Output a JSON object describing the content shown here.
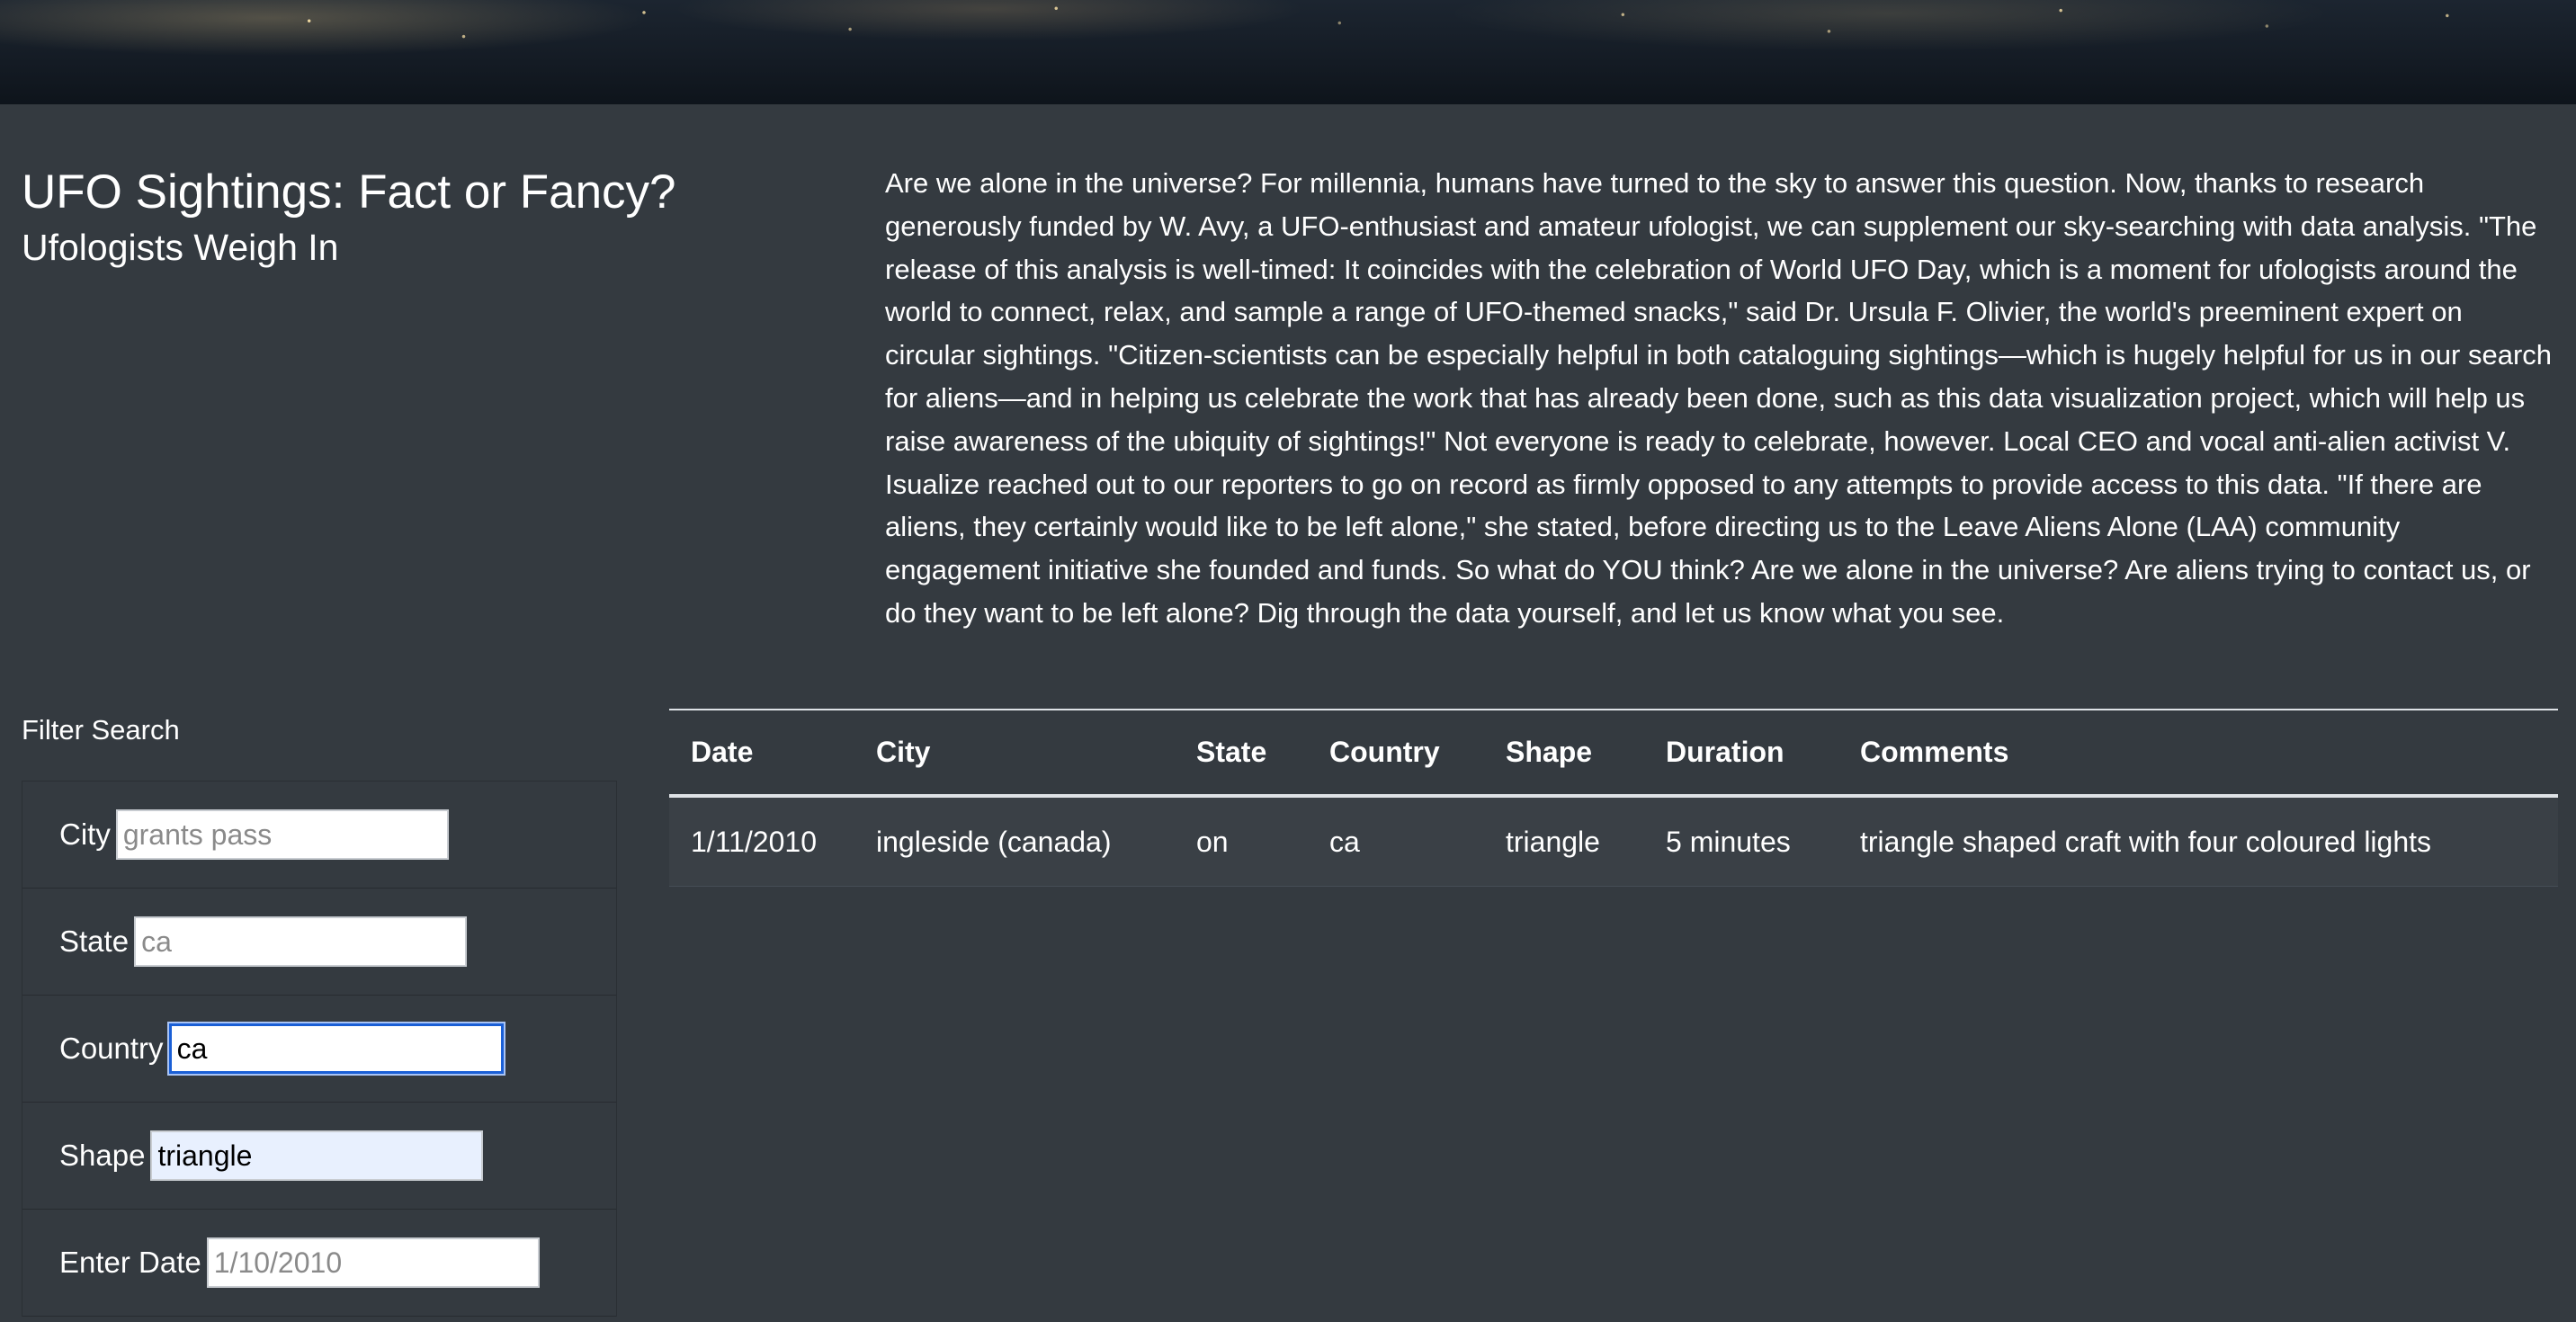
{
  "header": {
    "title": "UFO Sightings: Fact or Fancy?",
    "subtitle": "Ufologists Weigh In"
  },
  "article": {
    "text": "Are we alone in the universe? For millennia, humans have turned to the sky to answer this question. Now, thanks to research generously funded by W. Avy, a UFO-enthusiast and amateur ufologist, we can supplement our sky-searching with data analysis. \"The release of this analysis is well-timed: It coincides with the celebration of World UFO Day, which is a moment for ufologists around the world to connect, relax, and sample a range of UFO-themed snacks,\" said Dr. Ursula F. Olivier, the world's preeminent expert on circular sightings. \"Citizen-scientists can be especially helpful in both cataloguing sightings—which is hugely helpful for us in our search for aliens—and in helping us celebrate the work that has already been done, such as this data visualization project, which will help us raise awareness of the ubiquity of sightings!\" Not everyone is ready to celebrate, however. Local CEO and vocal anti-alien activist V. Isualize reached out to our reporters to go on record as firmly opposed to any attempts to provide access to this data. \"If there are aliens, they certainly would like to be left alone,\" she stated, before directing us to the Leave Aliens Alone (LAA) community engagement initiative she founded and funds. So what do YOU think? Are we alone in the universe? Are aliens trying to contact us, or do they want to be left alone? Dig through the data yourself, and let us know what you see."
  },
  "filters": {
    "title": "Filter Search",
    "city": {
      "label": "City",
      "value": "",
      "placeholder": "grants pass"
    },
    "state": {
      "label": "State",
      "value": "",
      "placeholder": "ca"
    },
    "country": {
      "label": "Country",
      "value": "ca",
      "placeholder": ""
    },
    "shape": {
      "label": "Shape",
      "value": "triangle",
      "placeholder": ""
    },
    "date": {
      "label": "Enter Date",
      "value": "",
      "placeholder": "1/10/2010"
    }
  },
  "table": {
    "headers": [
      "Date",
      "City",
      "State",
      "Country",
      "Shape",
      "Duration",
      "Comments"
    ],
    "rows": [
      [
        "1/11/2010",
        "ingleside (canada)",
        "on",
        "ca",
        "triangle",
        "5 minutes",
        "triangle shaped craft with four coloured lights"
      ]
    ]
  }
}
